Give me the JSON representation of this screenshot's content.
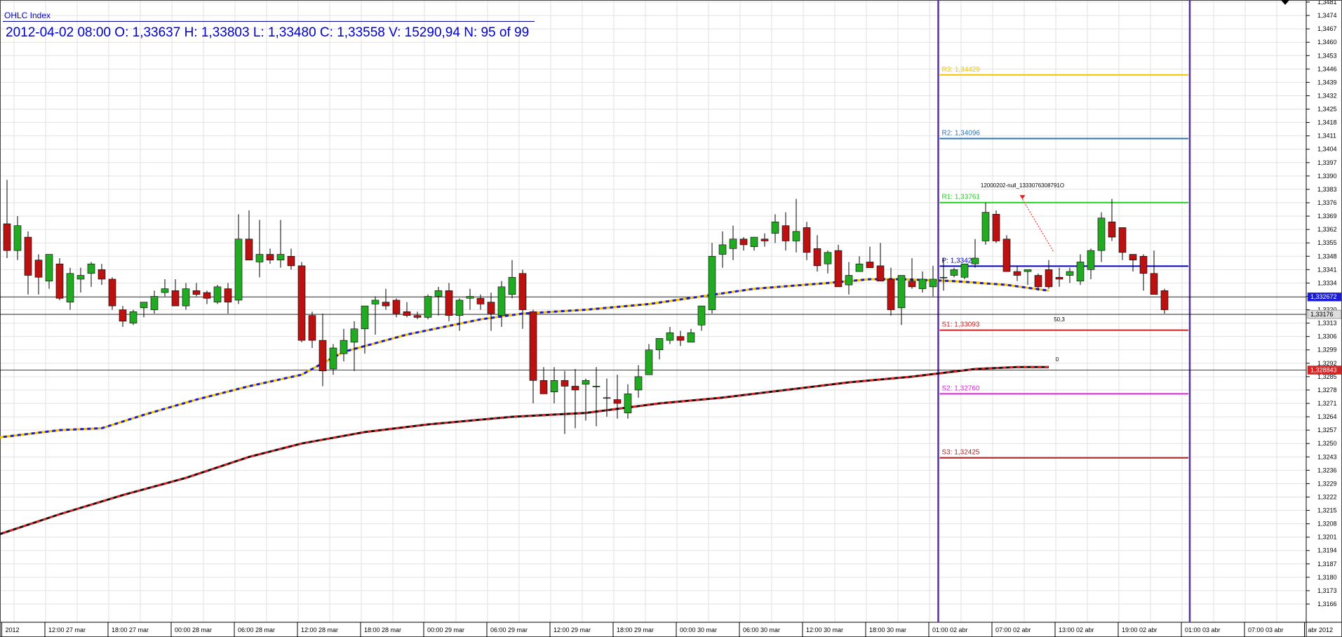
{
  "header": {
    "title": "OHLC Index",
    "info": "2012-04-02 08:00 O: 1,33637 H: 1,33803 L: 1,33480 C: 1,33558 V: 15290,94 N: 95 of 99"
  },
  "colors": {
    "up": "#22aa22",
    "down": "#bb1111",
    "grid": "#e2e2e2",
    "ma_fast_a": "#f2c200",
    "ma_fast_b": "#1a1adc",
    "ma_slow_a": "#111111",
    "ma_slow_b": "#dd2222",
    "session_line": "#553399",
    "price_line": "#000000"
  },
  "chart_data": {
    "type": "candlestick",
    "y_axis": {
      "min": 1.3159,
      "max": 1.3481,
      "step": 0.0007,
      "first_tick": 1.3166,
      "tick_labels": [
        "1,3166",
        "1,3173",
        "1,3180",
        "1,3187",
        "1,3194",
        "1,3201",
        "1,3208",
        "1,3215",
        "1,3222",
        "1,3229",
        "1,3236",
        "1,3243",
        "1,3250",
        "1,3257",
        "1,3264",
        "1,3271",
        "1,3278",
        "1,3285",
        "1,3292",
        "1,3299",
        "1,3306",
        "1,3313",
        "1,3320",
        "1,3327",
        "1,3334",
        "1,3341",
        "1,3348",
        "1,3355",
        "1,3362",
        "1,3369",
        "1,3376",
        "1,3383",
        "1,3390",
        "1,3397",
        "1,3404",
        "1,3411",
        "1,3418",
        "1,3425",
        "1,3432",
        "1,3439",
        "1,3446",
        "1,3453",
        "1,3460",
        "1,3467",
        "1,3474",
        "1,3481"
      ]
    },
    "x_axis": {
      "labels": [
        {
          "index": -0.5,
          "text": "2012"
        },
        {
          "index": 3.6,
          "text": "12:00 27 mar"
        },
        {
          "index": 9.6,
          "text": "18:00 27 mar"
        },
        {
          "index": 15.6,
          "text": "00:00 28 mar"
        },
        {
          "index": 21.6,
          "text": "06:00 28 mar"
        },
        {
          "index": 27.6,
          "text": "12:00 28 mar"
        },
        {
          "index": 33.6,
          "text": "18:00 28 mar"
        },
        {
          "index": 39.6,
          "text": "00:00 29 mar"
        },
        {
          "index": 45.6,
          "text": "06:00 29 mar"
        },
        {
          "index": 51.6,
          "text": "12:00 29 mar"
        },
        {
          "index": 57.6,
          "text": "18:00 29 mar"
        },
        {
          "index": 63.6,
          "text": "00:00 30 mar"
        },
        {
          "index": 69.6,
          "text": "06:00 30 mar"
        },
        {
          "index": 75.6,
          "text": "12:00 30 mar"
        },
        {
          "index": 81.6,
          "text": "18:00 30 mar"
        },
        {
          "index": 87.6,
          "text": "01:00 02 abr"
        },
        {
          "index": 93.6,
          "text": "07:00 02 abr"
        },
        {
          "index": 99.6,
          "text": "13:00 02 abr"
        },
        {
          "index": 105.6,
          "text": "19:00 02 abr"
        },
        {
          "index": 111.6,
          "text": "01:00 03 abr"
        },
        {
          "index": 117.6,
          "text": "07:00 03 abr"
        },
        {
          "index": 123.3,
          "text": "abr 2012"
        }
      ]
    },
    "candles": [
      [
        1.3365,
        1.3388,
        1.3347,
        1.3351
      ],
      [
        1.3351,
        1.3369,
        1.3346,
        1.3364
      ],
      [
        1.3358,
        1.3361,
        1.3328,
        1.3338
      ],
      [
        1.3346,
        1.3349,
        1.3328,
        1.3337
      ],
      [
        1.3335,
        1.3349,
        1.3331,
        1.3349
      ],
      [
        1.3344,
        1.3347,
        1.3325,
        1.3326
      ],
      [
        1.3324,
        1.3342,
        1.332,
        1.3339
      ],
      [
        1.3336,
        1.3342,
        1.3329,
        1.3338
      ],
      [
        1.3339,
        1.3345,
        1.3332,
        1.3344
      ],
      [
        1.3341,
        1.3344,
        1.3333,
        1.3336
      ],
      [
        1.3336,
        1.3337,
        1.332,
        1.3322
      ],
      [
        1.332,
        1.3322,
        1.3311,
        1.3314
      ],
      [
        1.3313,
        1.332,
        1.3312,
        1.3319
      ],
      [
        1.3321,
        1.3324,
        1.3316,
        1.3324
      ],
      [
        1.332,
        1.333,
        1.3318,
        1.3327
      ],
      [
        1.3329,
        1.3336,
        1.3327,
        1.3331
      ],
      [
        1.333,
        1.3336,
        1.3326,
        1.3322
      ],
      [
        1.3322,
        1.3334,
        1.332,
        1.3331
      ],
      [
        1.333,
        1.3334,
        1.3327,
        1.3328
      ],
      [
        1.3329,
        1.333,
        1.3323,
        1.3326
      ],
      [
        1.3324,
        1.3333,
        1.3323,
        1.3332
      ],
      [
        1.3331,
        1.3334,
        1.3318,
        1.3324
      ],
      [
        1.3325,
        1.337,
        1.3323,
        1.3357
      ],
      [
        1.3357,
        1.3372,
        1.335,
        1.3346
      ],
      [
        1.3345,
        1.3367,
        1.3337,
        1.3349
      ],
      [
        1.3349,
        1.3352,
        1.3344,
        1.3346
      ],
      [
        1.3346,
        1.3367,
        1.3342,
        1.3349
      ],
      [
        1.3348,
        1.3352,
        1.3341,
        1.3343
      ],
      [
        1.3343,
        1.3345,
        1.3303,
        1.3304
      ],
      [
        1.3317,
        1.3319,
        1.33,
        1.3304
      ],
      [
        1.3304,
        1.3318,
        1.328,
        1.3288
      ],
      [
        1.3289,
        1.3302,
        1.3286,
        1.33
      ],
      [
        1.3297,
        1.331,
        1.3293,
        1.3304
      ],
      [
        1.3303,
        1.3314,
        1.3288,
        1.331
      ],
      [
        1.331,
        1.3317,
        1.3297,
        1.3322
      ],
      [
        1.3323,
        1.3327,
        1.3307,
        1.3325
      ],
      [
        1.3324,
        1.3331,
        1.332,
        1.3322
      ],
      [
        1.3325,
        1.3326,
        1.3316,
        1.3318
      ],
      [
        1.3319,
        1.3324,
        1.3316,
        1.3317
      ],
      [
        1.3317,
        1.3319,
        1.3315,
        1.3316
      ],
      [
        1.3316,
        1.3328,
        1.3315,
        1.3327
      ],
      [
        1.3327,
        1.3332,
        1.3317,
        1.333
      ],
      [
        1.333,
        1.3334,
        1.3314,
        1.3317
      ],
      [
        1.3317,
        1.3326,
        1.3309,
        1.3325
      ],
      [
        1.3326,
        1.3331,
        1.332,
        1.3327
      ],
      [
        1.3326,
        1.3328,
        1.332,
        1.3323
      ],
      [
        1.3324,
        1.3329,
        1.3309,
        1.3318
      ],
      [
        1.3317,
        1.3335,
        1.3311,
        1.3332
      ],
      [
        1.3328,
        1.3346,
        1.3326,
        1.3337
      ],
      [
        1.3339,
        1.3341,
        1.331,
        1.332
      ],
      [
        1.3319,
        1.332,
        1.3271,
        1.3283
      ],
      [
        1.3283,
        1.329,
        1.3276,
        1.3276
      ],
      [
        1.3277,
        1.329,
        1.3271,
        1.3283
      ],
      [
        1.3283,
        1.3288,
        1.3255,
        1.328
      ],
      [
        1.328,
        1.3289,
        1.3258,
        1.3278
      ],
      [
        1.3281,
        1.3284,
        1.3262,
        1.3283
      ],
      [
        1.328,
        1.329,
        1.3259,
        1.328
      ],
      [
        1.3274,
        1.3284,
        1.3264,
        1.3274
      ],
      [
        1.3273,
        1.3286,
        1.3263,
        1.3271
      ],
      [
        1.3266,
        1.3281,
        1.3263,
        1.3276
      ],
      [
        1.3278,
        1.3291,
        1.3274,
        1.3285
      ],
      [
        1.3286,
        1.3302,
        1.3286,
        1.3299
      ],
      [
        1.3299,
        1.3305,
        1.3294,
        1.3305
      ],
      [
        1.3304,
        1.3311,
        1.3302,
        1.3308
      ],
      [
        1.3306,
        1.3309,
        1.3301,
        1.3304
      ],
      [
        1.3303,
        1.331,
        1.3303,
        1.3308
      ],
      [
        1.3312,
        1.3322,
        1.3309,
        1.3322
      ],
      [
        1.332,
        1.3355,
        1.3318,
        1.3348
      ],
      [
        1.3349,
        1.3361,
        1.3342,
        1.3354
      ],
      [
        1.3352,
        1.3364,
        1.3346,
        1.3357
      ],
      [
        1.3357,
        1.3358,
        1.3351,
        1.3354
      ],
      [
        1.3353,
        1.3358,
        1.3351,
        1.3358
      ],
      [
        1.3357,
        1.336,
        1.3353,
        1.3356
      ],
      [
        1.336,
        1.337,
        1.3355,
        1.3366
      ],
      [
        1.3364,
        1.3371,
        1.3351,
        1.3356
      ],
      [
        1.3356,
        1.3378,
        1.335,
        1.3361
      ],
      [
        1.3363,
        1.3366,
        1.3346,
        1.335
      ],
      [
        1.3352,
        1.3359,
        1.334,
        1.3343
      ],
      [
        1.3344,
        1.3351,
        1.3339,
        1.335
      ],
      [
        1.3351,
        1.3354,
        1.3334,
        1.3332
      ],
      [
        1.3333,
        1.3345,
        1.3328,
        1.3338
      ],
      [
        1.334,
        1.3348,
        1.3341,
        1.3344
      ],
      [
        1.3345,
        1.3353,
        1.3342,
        1.3342
      ],
      [
        1.3343,
        1.3355,
        1.3341,
        1.3335
      ],
      [
        1.3336,
        1.3342,
        1.3317,
        1.332
      ],
      [
        1.3321,
        1.3338,
        1.3312,
        1.3338
      ],
      [
        1.3335,
        1.3347,
        1.3331,
        1.3332
      ],
      [
        1.3331,
        1.334,
        1.3329,
        1.3336
      ],
      [
        1.3332,
        1.3343,
        1.3327,
        1.3336
      ],
      [
        1.3337,
        1.3347,
        1.333,
        1.3337
      ],
      [
        1.3338,
        1.3342,
        1.3337,
        1.3341
      ],
      [
        1.3337,
        1.3344,
        1.3336,
        1.3344
      ],
      [
        1.3344,
        1.3357,
        1.3342,
        1.3347
      ],
      [
        1.3356,
        1.3376,
        1.3354,
        1.3371
      ],
      [
        1.337,
        1.3372,
        1.3355,
        1.3356
      ],
      [
        1.3357,
        1.3359,
        1.334,
        1.334
      ],
      [
        1.334,
        1.3343,
        1.3335,
        1.3338
      ],
      [
        1.334,
        1.3341,
        1.3333,
        1.3341
      ],
      [
        1.3338,
        1.3339,
        1.333,
        1.3332
      ],
      [
        1.3341,
        1.3346,
        1.3331,
        1.3332
      ],
      [
        1.3337,
        1.3342,
        1.3332,
        1.3336
      ],
      [
        1.3338,
        1.3342,
        1.3334,
        1.334
      ],
      [
        1.3335,
        1.3349,
        1.3333,
        1.3345
      ],
      [
        1.3341,
        1.3352,
        1.3336,
        1.3351
      ],
      [
        1.3351,
        1.3371,
        1.3345,
        1.3368
      ],
      [
        1.3366,
        1.3378,
        1.3356,
        1.3358
      ],
      [
        1.3363,
        1.3363,
        1.3346,
        1.335
      ],
      [
        1.3349,
        1.3349,
        1.334,
        1.3346
      ],
      [
        1.3348,
        1.3349,
        1.333,
        1.3339
      ],
      [
        1.3339,
        1.3351,
        1.333,
        1.3328
      ],
      [
        1.333,
        1.3331,
        1.3318,
        1.332
      ]
    ],
    "ma_fast": [
      [
        -1,
        1.3253
      ],
      [
        5,
        1.3257
      ],
      [
        9,
        1.3258
      ],
      [
        13,
        1.3265
      ],
      [
        18,
        1.3273
      ],
      [
        23,
        1.328
      ],
      [
        28,
        1.3286
      ],
      [
        32,
        1.3298
      ],
      [
        38,
        1.3307
      ],
      [
        45,
        1.3315
      ],
      [
        49,
        1.3318
      ],
      [
        55,
        1.332
      ],
      [
        61,
        1.3323
      ],
      [
        66,
        1.3327
      ],
      [
        71,
        1.3331
      ],
      [
        78,
        1.3334
      ],
      [
        82,
        1.3336
      ],
      [
        85,
        1.3336
      ],
      [
        90,
        1.3335
      ],
      [
        95,
        1.3333
      ],
      [
        99,
        1.333
      ]
    ],
    "ma_slow": [
      [
        -1,
        1.3202
      ],
      [
        5,
        1.3213
      ],
      [
        11,
        1.3223
      ],
      [
        17,
        1.3232
      ],
      [
        23,
        1.3243
      ],
      [
        28,
        1.325
      ],
      [
        34,
        1.3256
      ],
      [
        40,
        1.326
      ],
      [
        48,
        1.3264
      ],
      [
        55,
        1.3266
      ],
      [
        62,
        1.3271
      ],
      [
        68,
        1.3274
      ],
      [
        74,
        1.3278
      ],
      [
        80,
        1.3282
      ],
      [
        86,
        1.3285
      ],
      [
        92,
        1.3289
      ],
      [
        96,
        1.329
      ],
      [
        99,
        1.329
      ]
    ],
    "pivots": [
      {
        "label": "R3: 1,34429",
        "value": 1.34429,
        "color": "#f2c200"
      },
      {
        "label": "R2: 1,34096",
        "value": 1.34096,
        "color": "#2e74b5"
      },
      {
        "label": "R1: 1,33761",
        "value": 1.33761,
        "color": "#22cc22"
      },
      {
        "label": "P: 1,33428",
        "value": 1.33428,
        "color": "#0000cc"
      },
      {
        "label": "S1: 1,33093",
        "value": 1.33093,
        "color": "#cc2222"
      },
      {
        "label": "S2: 1,32760",
        "value": 1.3276,
        "color": "#dd22dd"
      },
      {
        "label": "S3: 1,32425",
        "value": 1.32425,
        "color": "#aa2222"
      }
    ],
    "session_lines_index": [
      88.5,
      112.4
    ],
    "price_markers": [
      {
        "label": "1,332672",
        "value": 1.332672,
        "bg": "#1a1adc",
        "fg": "#ffffff"
      },
      {
        "label": "1,33176",
        "value": 1.33176,
        "bg": "#dddddd",
        "fg": "#000000"
      },
      {
        "label": "1,328843",
        "value": 1.328843,
        "bg": "#dd2222",
        "fg": "#ffffff"
      }
    ],
    "annotations": [
      {
        "text": "12000202-null_1333076308791O",
        "index": 96.5,
        "value": 1.3384
      },
      {
        "text": "50,3",
        "index": 100,
        "value": 1.3314
      },
      {
        "text": "0",
        "index": 99.8,
        "value": 1.3293
      }
    ]
  }
}
